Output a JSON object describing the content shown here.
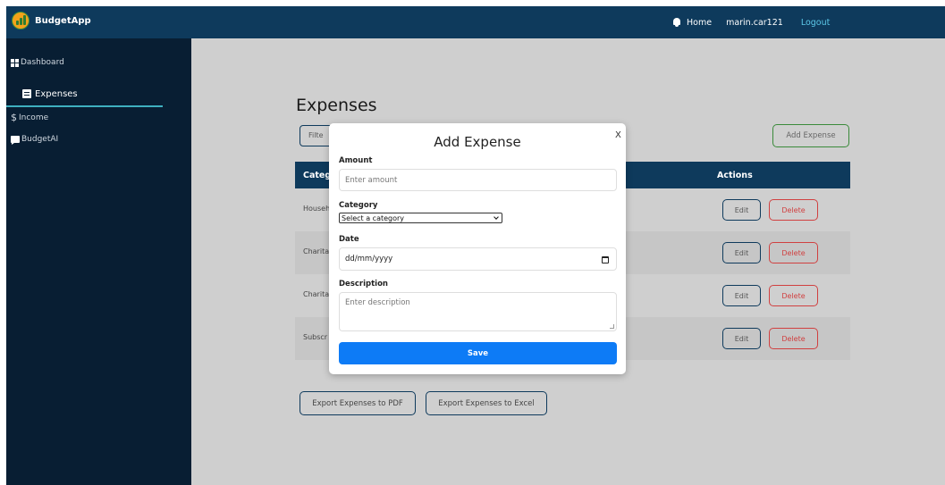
{
  "brand": {
    "name": "BudgetApp"
  },
  "topnav": {
    "home": "Home",
    "user": "marin.car121",
    "logout": "Logout"
  },
  "sidebar": {
    "items": [
      {
        "label": "Dashboard",
        "icon": "dashboard-icon"
      },
      {
        "label": "Expenses",
        "icon": "document-icon",
        "active": true
      },
      {
        "label": "Income",
        "icon": "dollar-icon"
      },
      {
        "label": "BudgetAI",
        "icon": "chat-icon"
      }
    ]
  },
  "page": {
    "title": "Expenses",
    "filter_label": "Filte",
    "add_label": "Add Expense",
    "table": {
      "col_category": "Categ",
      "col_actions": "Actions",
      "rows": [
        {
          "category": "Househ"
        },
        {
          "category": "Charita"
        },
        {
          "category": "Charita"
        },
        {
          "category": "Subscr"
        }
      ],
      "edit_label": "Edit",
      "delete_label": "Delete"
    },
    "export_pdf": "Export Expenses to PDF",
    "export_excel": "Export Expenses to Excel"
  },
  "modal": {
    "title": "Add Expense",
    "close": "X",
    "amount_label": "Amount",
    "amount_placeholder": "Enter amount",
    "category_label": "Category",
    "category_selected": "Select a category",
    "date_label": "Date",
    "date_placeholder": "dd/mm/yyyy",
    "description_label": "Description",
    "description_placeholder": "Enter description",
    "save_label": "Save"
  },
  "colors": {
    "nav": "#0e3a5c",
    "sidebar": "#081e33",
    "save": "#0d7bf6",
    "delete": "#d04040",
    "add": "#3a8a3a"
  }
}
